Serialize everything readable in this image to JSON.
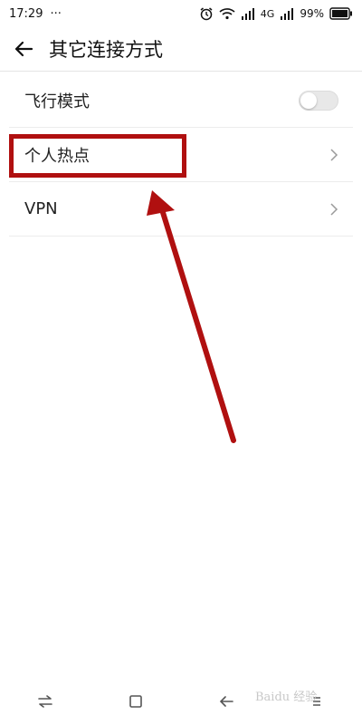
{
  "status_bar": {
    "time": "17:29",
    "more": "···",
    "network": "4G",
    "battery": "99%"
  },
  "header": {
    "title": "其它连接方式"
  },
  "settings": {
    "items": [
      {
        "label": "飞行模式",
        "control": "toggle",
        "on": false
      },
      {
        "label": "个人热点",
        "control": "chevron"
      },
      {
        "label": "VPN",
        "control": "chevron"
      }
    ]
  },
  "annotation": {
    "highlight_color": "#b01010",
    "arrow_color": "#b01010"
  },
  "watermark": {
    "text": "Baidu 经验"
  },
  "icons": {
    "back": "arrow-left-icon",
    "chevron": "chevron-right-icon",
    "nav_back": "back-arrow-icon",
    "nav_home": "home-square-icon",
    "nav_recents": "switch-arrows-icon",
    "nav_menu": "menu-icon"
  }
}
